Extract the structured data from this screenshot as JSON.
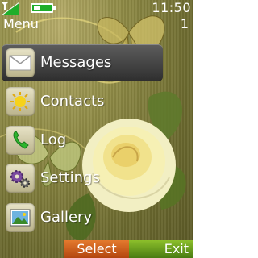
{
  "status": {
    "time": "11:50",
    "count": "1"
  },
  "header": {
    "title": "Menu"
  },
  "menu": {
    "items": [
      {
        "label": "Messages",
        "icon": "envelope-icon",
        "selected": true
      },
      {
        "label": "Contacts",
        "icon": "sun-icon",
        "selected": false
      },
      {
        "label": "Log",
        "icon": "phone-icon",
        "selected": false
      },
      {
        "label": "Settings",
        "icon": "gears-icon",
        "selected": false
      },
      {
        "label": "Gallery",
        "icon": "picture-icon",
        "selected": false
      }
    ]
  },
  "softkeys": {
    "left": "Select",
    "right": "Exit"
  },
  "colors": {
    "select_key": "#d0631f",
    "exit_key": "#6ea31f",
    "battery": "#1fae2a"
  }
}
